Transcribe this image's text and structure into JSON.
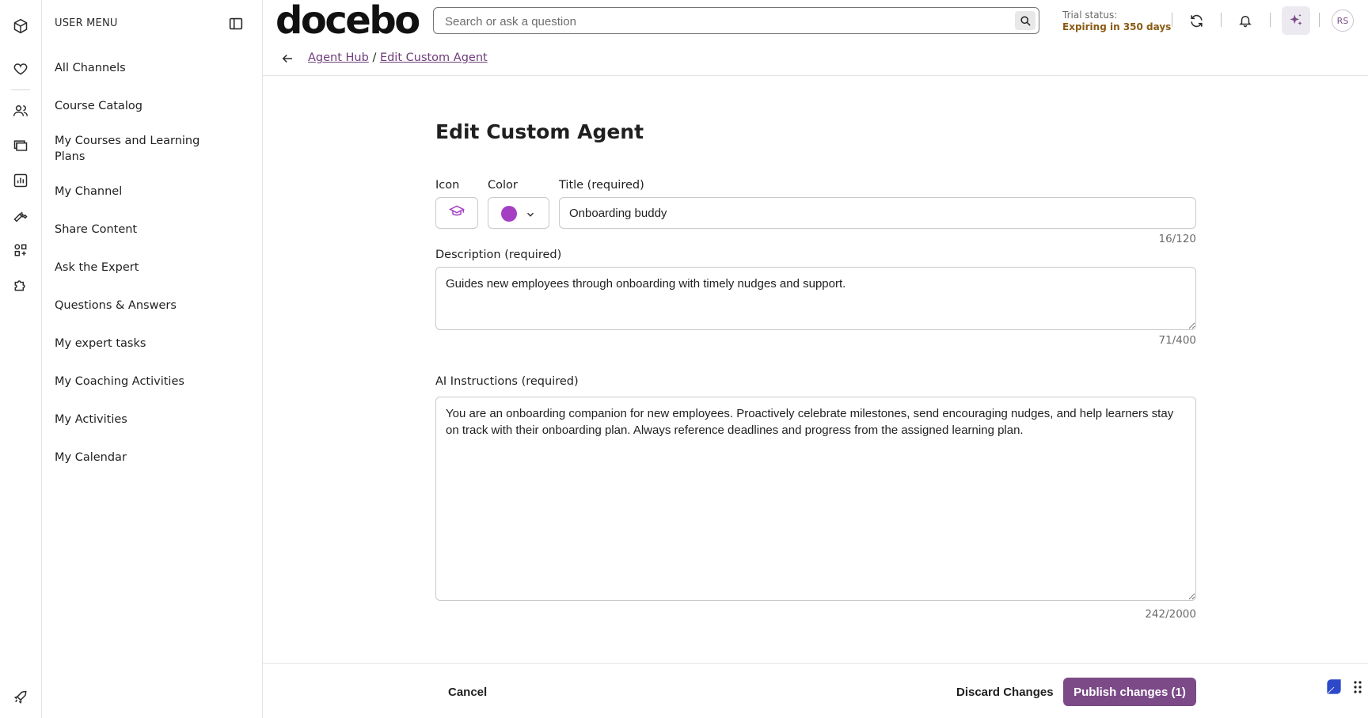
{
  "theme": {
    "accent": "#7b4a87",
    "agent_color": "#a43fc4",
    "trial_color": "#8a5a14"
  },
  "rail": {
    "icons": [
      "cube-icon",
      "heart-icon",
      "users-icon",
      "folders-icon",
      "analytics-icon",
      "wrench-icon",
      "apps-icon",
      "puzzle-icon",
      "rocket-icon"
    ]
  },
  "user_menu": {
    "title": "USER MENU",
    "items": [
      {
        "label": "All Channels"
      },
      {
        "label": "Course Catalog"
      },
      {
        "label": "My Courses and Learning Plans"
      },
      {
        "label": "My Channel"
      },
      {
        "label": "Share Content"
      },
      {
        "label": "Ask the Expert"
      },
      {
        "label": "Questions & Answers"
      },
      {
        "label": "My expert tasks"
      },
      {
        "label": "My Coaching Activities"
      },
      {
        "label": "My Activities"
      },
      {
        "label": "My Calendar"
      }
    ]
  },
  "header": {
    "logo": "docebo",
    "search_placeholder": "Search or ask a question",
    "trial_label": "Trial status:",
    "trial_value": "Expiring in 350 days",
    "avatar_initials": "RS"
  },
  "breadcrumb": {
    "parent": "Agent Hub",
    "separator": "/",
    "current": "Edit Custom Agent"
  },
  "form": {
    "page_title": "Edit Custom Agent",
    "icon_label": "Icon",
    "icon_value": "graduation-cap-icon",
    "color_label": "Color",
    "title_label": "Title (required)",
    "title_value": "Onboarding buddy",
    "title_counter": "16/120",
    "description_label": "Description (required)",
    "description_value": "Guides new employees through onboarding with timely nudges and support.",
    "description_counter": "71/400",
    "ai_label": "AI Instructions (required)",
    "ai_value": "You are an onboarding companion for new employees. Proactively celebrate milestones, send encouraging nudges, and help learners stay on track with their onboarding plan. Always reference deadlines and progress from the assigned learning plan.",
    "ai_counter": "242/2000"
  },
  "footer": {
    "cancel": "Cancel",
    "discard": "Discard Changes",
    "publish": "Publish changes (1)"
  }
}
